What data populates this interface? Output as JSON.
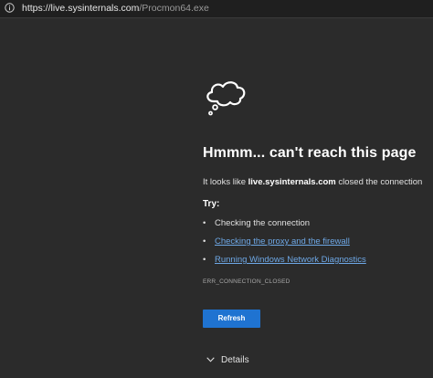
{
  "address_bar": {
    "icon": "info-icon",
    "url_host": "https://live.sysinternals.com",
    "url_path": "/Procmon64.exe"
  },
  "error_page": {
    "icon": "thought-cloud-icon",
    "title": "Hmmm... can't reach this page",
    "message_prefix": "It looks like ",
    "message_host": "live.sysinternals.com",
    "message_suffix": " closed the connection",
    "try_label": "Try:",
    "suggestions": [
      {
        "bullet": "•",
        "text": "Checking the connection",
        "is_link": false
      },
      {
        "bullet": "•",
        "text": "Checking the proxy and the firewall",
        "is_link": true
      },
      {
        "bullet": "•",
        "text": "Running Windows Network Diagnostics",
        "is_link": true
      }
    ],
    "error_code": "ERR_CONNECTION_CLOSED",
    "refresh_label": "Refresh",
    "details_label": "Details",
    "colors": {
      "background": "#2b2b2b",
      "link": "#6ea8e6",
      "button": "#1f73d1"
    }
  }
}
